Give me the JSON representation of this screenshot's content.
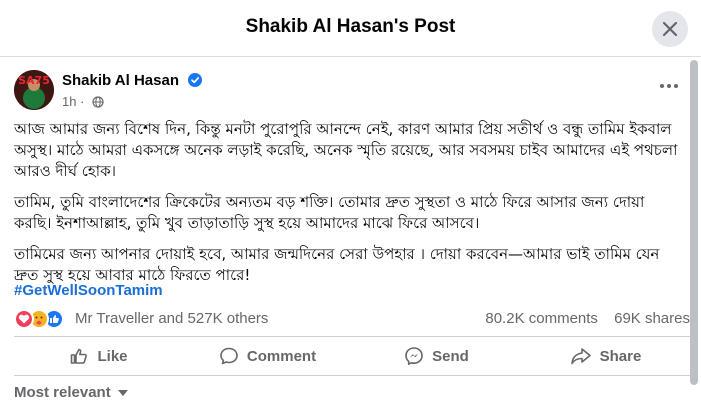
{
  "header": {
    "title": "Shakib Al Hasan's Post"
  },
  "post": {
    "author": "Shakib Al Hasan",
    "avatar_text": "SA75",
    "time": "1h",
    "paragraphs": [
      "আজ আমার জন্য বিশেষ দিন, কিন্তু মনটা পুরোপুরি আনন্দে নেই, কারণ আমার প্রিয় সতীর্থ ও বন্ধু তামিম ইকবাল অসুস্থ। মাঠে আমরা একসঙ্গে অনেক লড়াই করেছি, অনেক স্মৃতি রয়েছে, আর সবসময় চাইব আমাদের এই পথচলা আরও দীর্ঘ হোক।",
      "তামিম, তুমি বাংলাদেশের ক্রিকেটের অন্যতম বড় শক্তি। তোমার দ্রুত সুস্থতা ও মাঠে ফিরে আসার জন্য দোয়া করছি। ইনশাআল্লাহ, তুমি খুব তাড়াতাড়ি সুস্থ হয়ে আমাদের মাঝে ফিরে আসবে।",
      "তামিমের জন্য আপনার দোয়াই হবে, আমার জন্মদিনের সেরা উপহার । দোয়া করবেন—আমার ভাই তামিম যেন দ্রুত সুস্থ হয়ে আবার মাঠে ফিরতে পারে!"
    ],
    "hashtag": "#GetWellSoonTamim"
  },
  "reactions": {
    "icons": [
      "love",
      "care",
      "like"
    ],
    "summary": "Mr Traveller and 527K others",
    "comments": "80.2K comments",
    "shares": "69K shares"
  },
  "actions": {
    "like": "Like",
    "comment": "Comment",
    "send": "Send",
    "share": "Share"
  },
  "comments": {
    "sort_label": "Most relevant"
  },
  "colors": {
    "like_blue": "#1877f2",
    "love_red": "#f33e58",
    "care_yellow": "#f7b125",
    "hashtag": "#1a6ed8"
  }
}
